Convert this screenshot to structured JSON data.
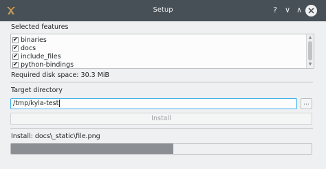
{
  "window": {
    "title": "Setup"
  },
  "titlebar": {
    "help_glyph": "?",
    "minimize_glyph": "∨",
    "maximize_glyph": "∧"
  },
  "features": {
    "heading": "Selected features",
    "items": [
      {
        "label": "binaries",
        "checked": true
      },
      {
        "label": "docs",
        "checked": true
      },
      {
        "label": "include_files",
        "checked": true
      },
      {
        "label": "python-bindings",
        "checked": true
      }
    ],
    "check_glyph": "✔"
  },
  "disk_space": "Required disk space: 30.3 MiB",
  "target": {
    "heading": "Target directory",
    "path": "/tmp/kyla-test",
    "browse_label": "..."
  },
  "install_button": "Install",
  "status": "Install: docs\\_static\\file.png",
  "progress": {
    "value": 0.54
  }
}
